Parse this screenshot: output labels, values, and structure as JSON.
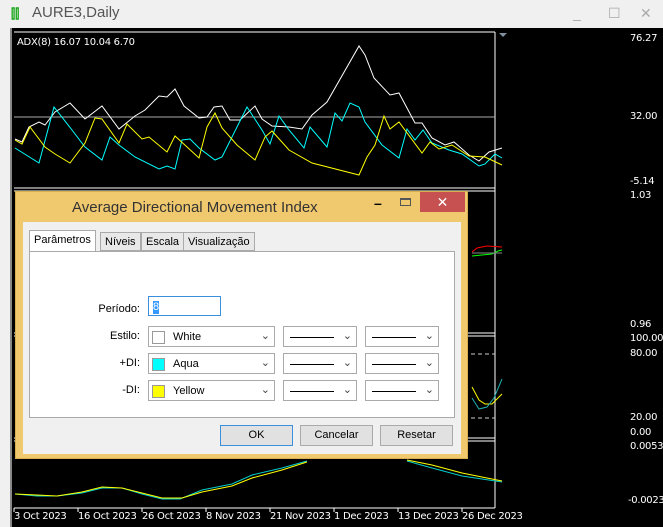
{
  "window": {
    "title": "AURE3,Daily",
    "minimize": "_",
    "maximize": "☐",
    "close": "✕"
  },
  "chart": {
    "indicator_label": "ADX(8) 16.07 10.04 6.70",
    "panel1_axis": [
      "76.27",
      "32.00",
      "-5.14"
    ],
    "panel2_axis": [
      "1.03",
      "0.96"
    ],
    "panel3_axis": [
      "100.00",
      "80.00",
      "20.00",
      "0.00"
    ],
    "panel4_axis": [
      "0.00535",
      "-0.00234"
    ],
    "dates": [
      "3 Oct 2023",
      "16 Oct 2023",
      "26 Oct 2023",
      "8 Nov 2023",
      "21 Nov 2023",
      "1 Dec 2023",
      "13 Dec 2023",
      "26 Dec 2023"
    ],
    "colors": {
      "adx": "#ffffff",
      "plus_di": "#00ffff",
      "minus_di": "#ffff00"
    }
  },
  "dialog": {
    "title": "Average Directional Movement Index",
    "tabs": [
      "Parâmetros",
      "Níveis",
      "Escala",
      "Visualização"
    ],
    "period_label": "Período:",
    "period_value": "8",
    "rows": [
      {
        "label": "Estilo:",
        "color_name": "White",
        "color": "#ffffff"
      },
      {
        "label": "+DI:",
        "color_name": "Aqua",
        "color": "#00ffff"
      },
      {
        "label": "-DI:",
        "color_name": "Yellow",
        "color": "#ffff00"
      }
    ],
    "ok": "OK",
    "cancel": "Cancelar",
    "reset": "Resetar"
  }
}
